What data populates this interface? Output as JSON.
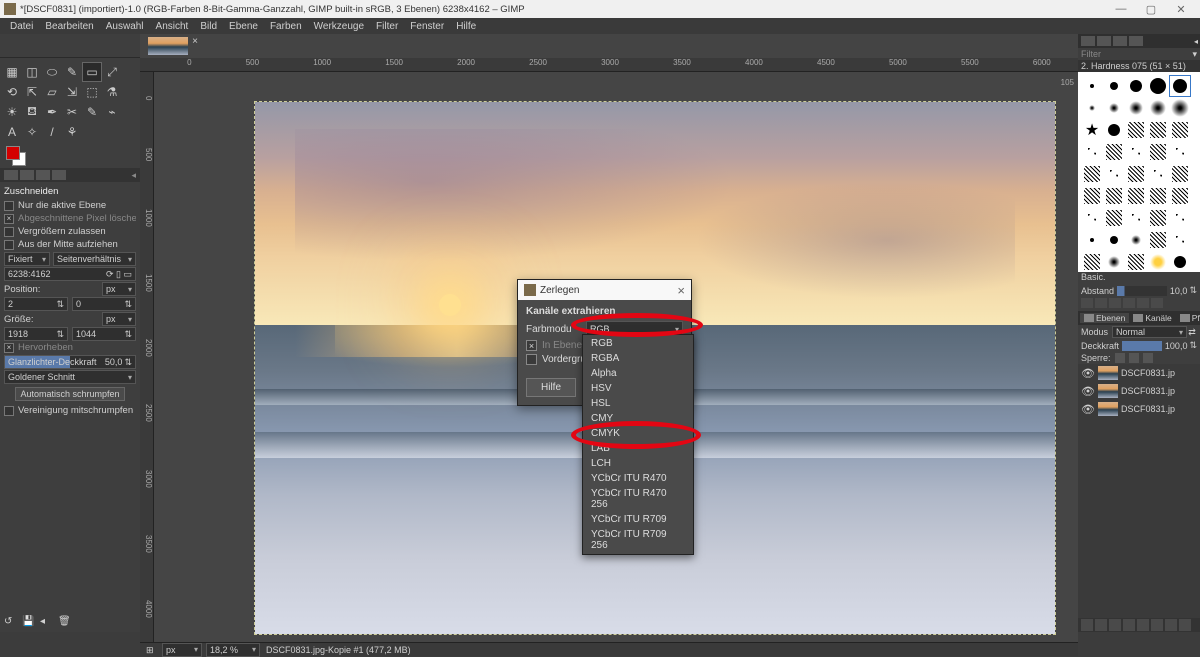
{
  "window": {
    "title": "*[DSCF0831] (importiert)-1.0 (RGB-Farben 8-Bit-Gamma-Ganzzahl, GIMP built-in sRGB, 3 Ebenen) 6238x4162 – GIMP",
    "min": "—",
    "max": "▢",
    "close": "✕"
  },
  "menu": [
    "Datei",
    "Bearbeiten",
    "Auswahl",
    "Ansicht",
    "Bild",
    "Ebene",
    "Farben",
    "Werkzeuge",
    "Filter",
    "Fenster",
    "Hilfe"
  ],
  "toolbox": {
    "tools": [
      "▦",
      "◫",
      "⬭",
      "✎",
      "▭",
      "⤢",
      "⟲",
      "⇱",
      "▱",
      "⇲",
      "⬚",
      "⚗",
      "☀",
      "⛾",
      "✒",
      "✂",
      "✎",
      "⌁",
      "A",
      "✧",
      "/",
      "⚘"
    ],
    "selected_index": 4,
    "fg_color": "#d40000",
    "bg_color": "#ffffff"
  },
  "toolOptions": {
    "title": "Zuschneiden",
    "only_active_layer": "Nur die aktive Ebene",
    "delete_cropped": "Abgeschnittene Pixel löschen",
    "allow_growing": "Vergrößern zulassen",
    "from_center": "Aus der Mitte aufziehen",
    "fixed": "Fixiert",
    "aspect_ratio": "Seitenverhältnis",
    "aspect_value": "6238:4162",
    "position_label": "Position:",
    "unit_px": "px",
    "pos_x": "2",
    "pos_y": "0",
    "size_label": "Größe:",
    "size_w": "1918",
    "size_h": "1044",
    "highlight": "Hervorheben",
    "hl_opacity_label": "Glanzlichter-Deckkraft",
    "hl_opacity_val": "50,0",
    "golden": "Goldener Schnitt",
    "auto_shrink": "Automatisch schrumpfen",
    "merge_shrink": "Vereinigung mitschrumpfen"
  },
  "rulerTop": [
    "0",
    "500",
    "1000",
    "1500",
    "2000",
    "2500",
    "3000",
    "3500",
    "4000",
    "4500",
    "5000",
    "5500",
    "6000"
  ],
  "rulerLeft": [
    "0",
    "500",
    "1000",
    "1500",
    "2000",
    "2500",
    "3000",
    "3500",
    "4000"
  ],
  "rulerRight": "105",
  "statusbar": {
    "unit": "px",
    "zoom": "18,2 %",
    "file": "DSCF0831.jpg-Kopie #1 (477,2 MB)"
  },
  "brushes": {
    "title_top": "2. Hardness 075 (51 × 51)",
    "filter_lbl": "Filter",
    "basic": "Basic.",
    "spacing_lbl": "Abstand",
    "spacing_val": "10,0"
  },
  "layersPanel": {
    "tabs": [
      "Ebenen",
      "Kanäle",
      "Pfade"
    ],
    "modus_lbl": "Modus",
    "modus_val": "Normal",
    "deck_lbl": "Deckkraft",
    "deck_val": "100,0",
    "sperre_lbl": "Sperre:",
    "layers": [
      "DSCF0831.jp",
      "DSCF0831.jp",
      "DSCF0831.jp"
    ]
  },
  "dialog": {
    "title": "Zerlegen",
    "section": "Kanäle extrahieren",
    "colormodel_lbl": "Farbmodu",
    "colormodel_val": "RGB",
    "in_layers": "In Ebenen z",
    "foreground": "Vordergrund",
    "help": "Hilfe"
  },
  "dropdown": {
    "items": [
      "RGB",
      "RGBA",
      "Alpha",
      "HSV",
      "HSL",
      "CMY",
      "CMYK",
      "LAB",
      "LCH",
      "YCbCr ITU R470",
      "YCbCr ITU R470 256",
      "YCbCr ITU R709",
      "YCbCr ITU R709 256"
    ]
  }
}
